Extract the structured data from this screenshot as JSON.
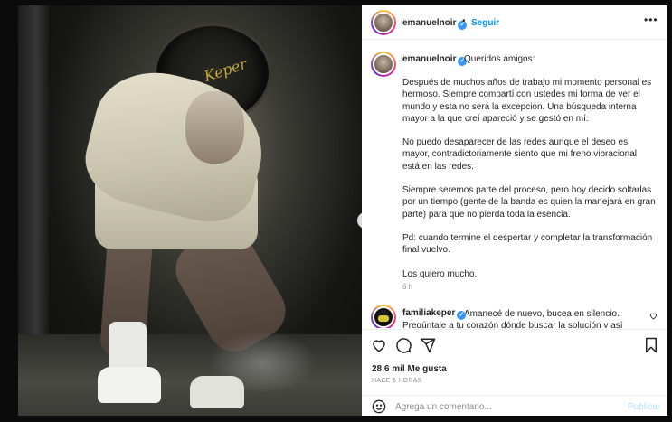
{
  "post": {
    "username": "emanuelnoir",
    "follow_label": "Seguir",
    "dot": "•",
    "more": "•••",
    "verified_icon": "✓"
  },
  "caption": {
    "greeting": "Queridos amigos:",
    "paragraphs": [
      "Después de muchos años de trabajo mi momento personal es hermoso. Siempre compartí con ustedes mi forma de ver el mundo y esta no será la excepción. Una búsqueda interna mayor a la que creí apareció y se gestó en mí.",
      "No puedo desaparecer de las redes aunque el deseo es mayor, contradictoriamente siento que mi freno vibracional está en las redes.",
      "Siempre seremos parte del proceso, pero hoy decido soltarlas por un tiempo (gente de la banda es quien la manejará en gran parte) para que no pierda toda la esencia.",
      "Pd: cuando termine el despertar y completar la transformación final vuelvo.",
      "Los quiero mucho."
    ],
    "time": "6 h"
  },
  "comment": {
    "username": "familiakeper",
    "text": "Amanecé de nuevo, bucea en silencio. Pregúntale a tu corazón dónde buscar la solución y así"
  },
  "likes": "28,6 mil Me gusta",
  "posted": "HACE 6 HORAS",
  "add_comment": {
    "placeholder": "Agrega un comentario...",
    "publish_label": "Publicar"
  },
  "photo": {
    "drum_logo": "Keper"
  },
  "colors": {
    "accent": "#0095f6",
    "verified": "#3897f0",
    "publish_disabled": "#b2dffc"
  },
  "icons": [
    "heart-icon",
    "comment-icon",
    "share-icon",
    "bookmark-icon",
    "emoji-icon",
    "chevron-right-icon",
    "more-icon",
    "verified-icon"
  ]
}
